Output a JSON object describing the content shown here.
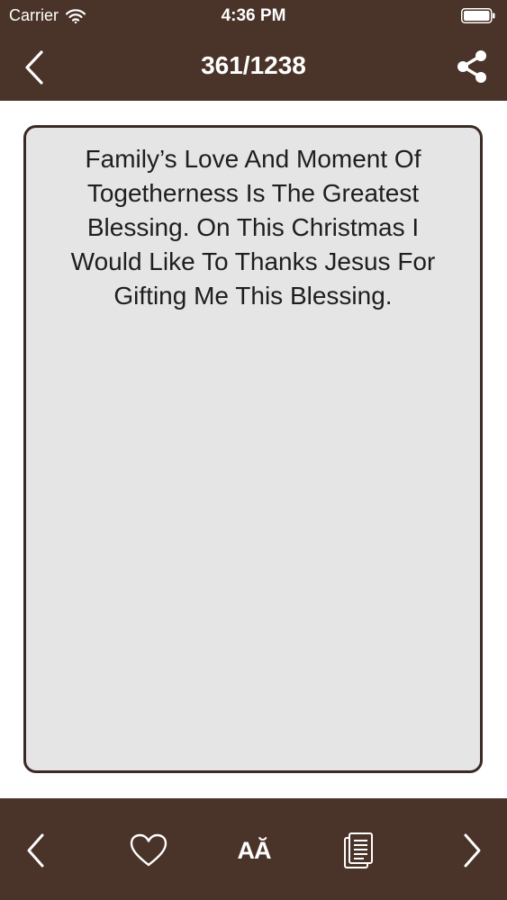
{
  "status_bar": {
    "carrier": "Carrier",
    "time": "4:36 PM"
  },
  "nav": {
    "title": "361/1238",
    "back_icon": "chevron-left-icon",
    "share_icon": "share-icon"
  },
  "quote": {
    "text": "Family’s Love And Moment Of Togetherness Is The Greatest Blessing. On This Christmas I Would Like To Thanks Jesus For Gifting Me This Blessing."
  },
  "toolbar": {
    "prev_icon": "chevron-left-icon",
    "favorite_icon": "heart-icon",
    "font_label": "AĂ",
    "copy_icon": "document-icon",
    "next_icon": "chevron-right-icon"
  },
  "colors": {
    "bar_background": "#4a3329",
    "card_background": "#e6e5e6",
    "card_border": "#3b2a23",
    "text": "#1e1e1e",
    "bar_foreground": "#ffffff"
  }
}
